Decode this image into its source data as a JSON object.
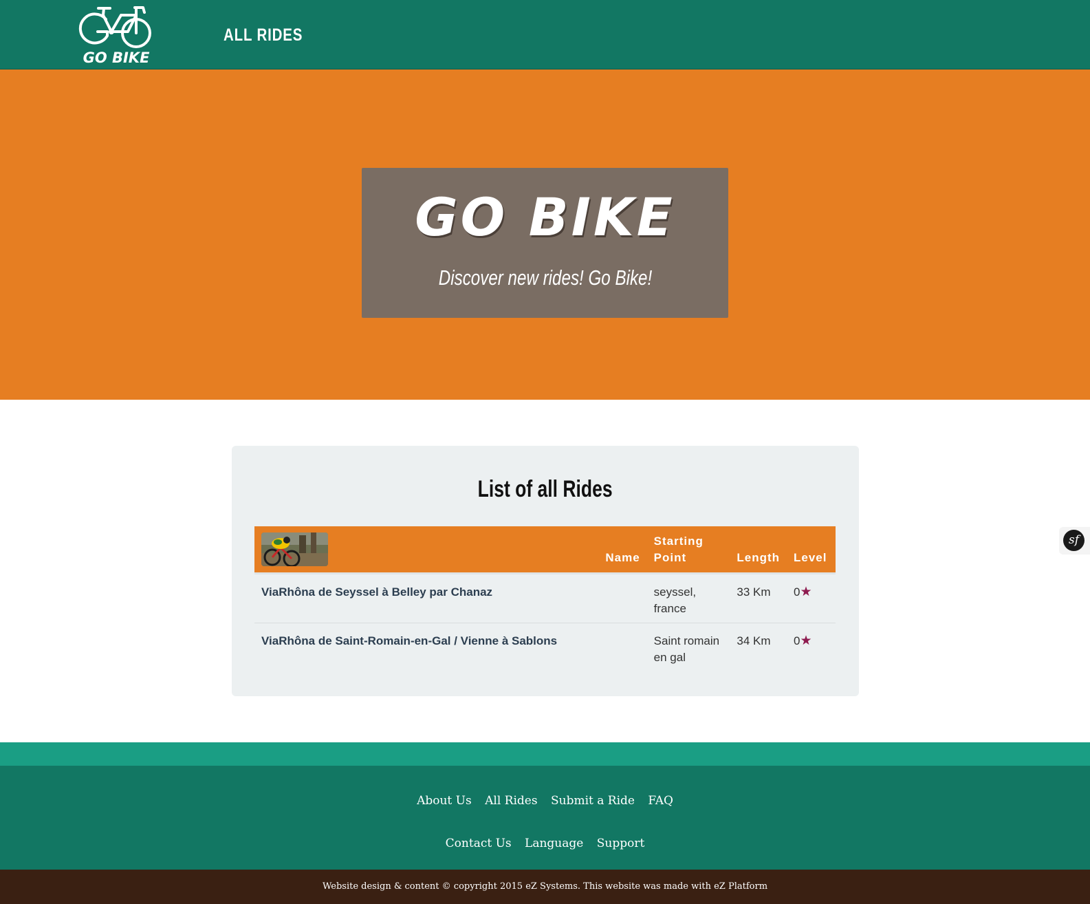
{
  "colors": {
    "header_bg": "#127763",
    "accent": "#e67e22",
    "star": "#8e1b4f"
  },
  "header": {
    "logo_text": "GO BIKE",
    "nav_label": "ALL RIDES"
  },
  "hero": {
    "title": "GO BIKE",
    "tagline": "Discover new rides! Go Bike!"
  },
  "rides_panel": {
    "title": "List of all Rides",
    "columns": {
      "name": "Name",
      "starting_point_line1": "Starting",
      "starting_point_line2": "Point",
      "length": "Length",
      "level": "Level"
    },
    "rows": [
      {
        "name": "ViaRhôna de Seyssel à Belley par Chanaz",
        "start_line1": "seyssel,",
        "start_line2": "france",
        "length": "33 Km",
        "level": "0",
        "level_icon": "star-icon"
      },
      {
        "name": "ViaRhôna de Saint-Romain-en-Gal / Vienne à Sablons",
        "start_line1": "Saint romain",
        "start_line2": "en gal",
        "length": "34 Km",
        "level": "0",
        "level_icon": "star-icon"
      }
    ]
  },
  "debug_toolbar": {
    "icon": "symfony-icon",
    "label": "sf"
  },
  "footer": {
    "links_row1": [
      "About Us",
      "All Rides",
      "Submit a Ride",
      "FAQ"
    ],
    "links_row2": [
      "Contact Us",
      "Language",
      "Support"
    ],
    "copyright": "Website design & content © copyright 2015 eZ Systems. This website was made with eZ Platform"
  }
}
